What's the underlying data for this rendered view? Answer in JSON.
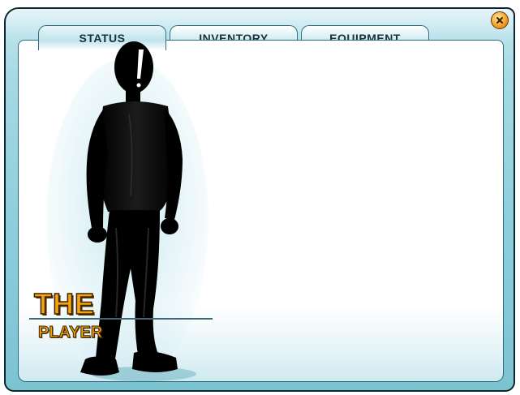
{
  "window": {
    "close_icon": "close-x-icon"
  },
  "tabs": [
    {
      "label": "STATUS",
      "active": true
    },
    {
      "label": "INVENTORY",
      "active": false
    },
    {
      "label": "EQUIPMENT",
      "active": false
    }
  ],
  "character": {
    "title_line1": "THE",
    "title_line2": "PLAYER",
    "figure_icon": "player-silhouette"
  },
  "colors": {
    "title_accent": "#f4a40f",
    "frame": "#8ecfdc",
    "panel": "#ffffff",
    "close_button": "#f3a32a"
  }
}
